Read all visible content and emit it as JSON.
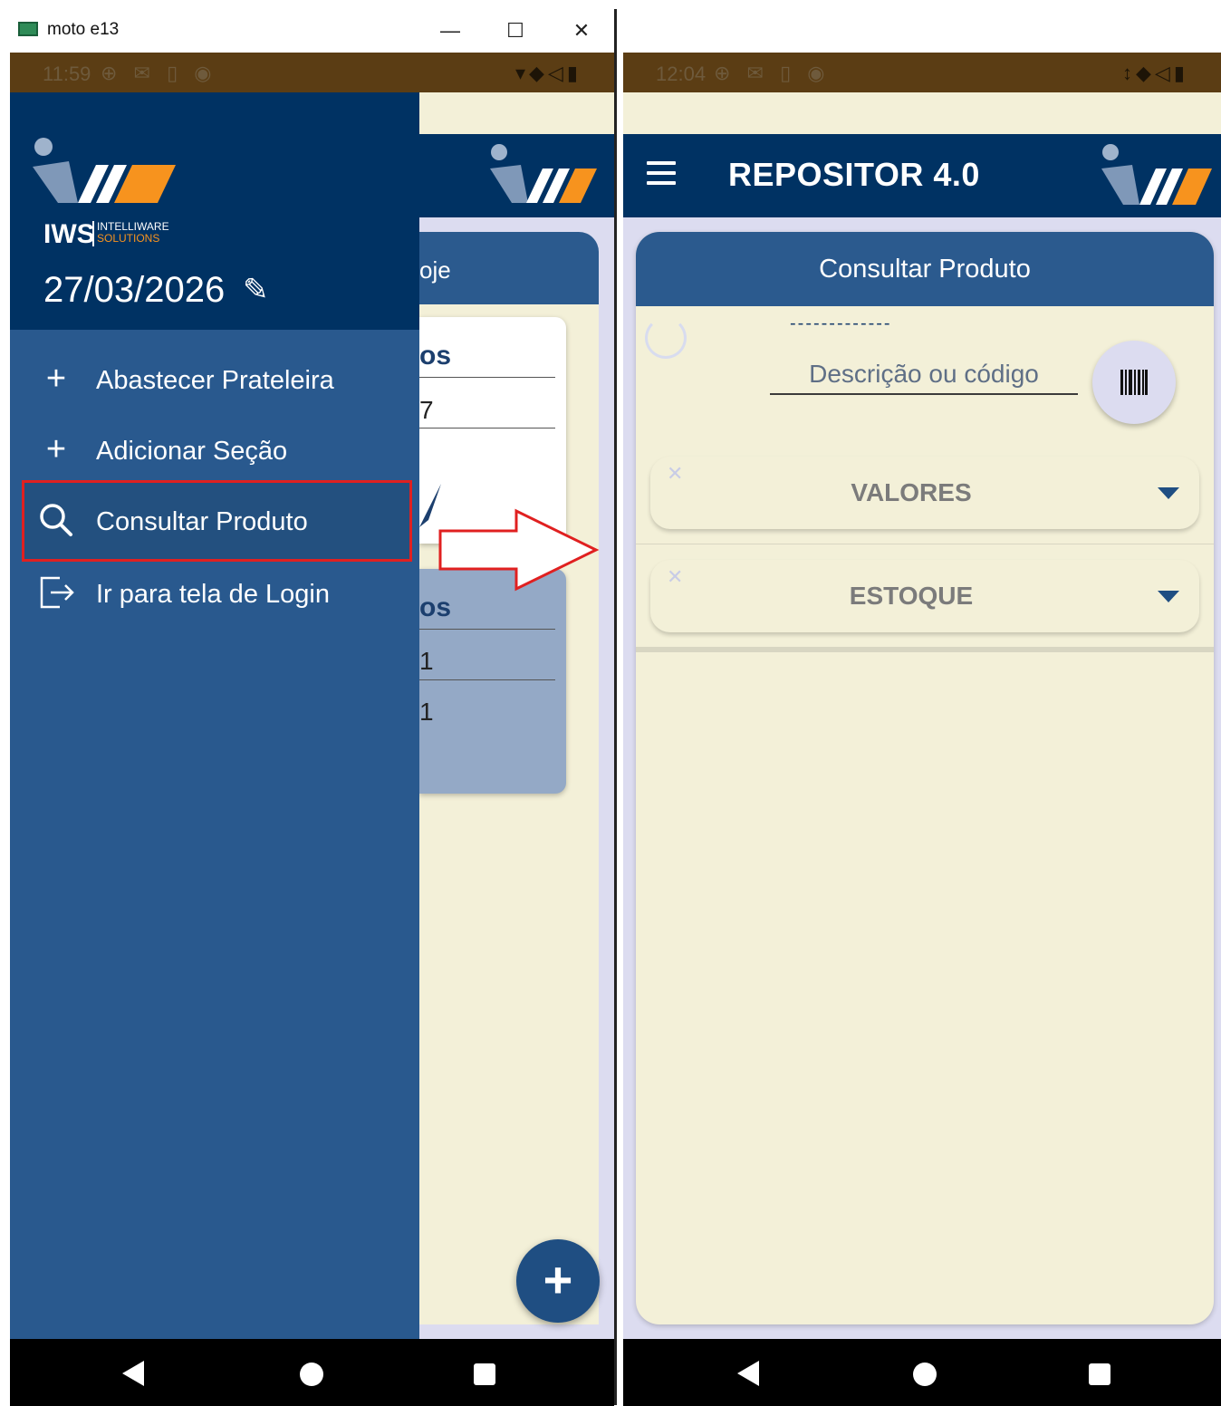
{
  "window": {
    "title": "moto e13",
    "minimize": "—",
    "maximize": "☐",
    "close": "✕"
  },
  "left_phone": {
    "status": {
      "time": "11:59",
      "left_icons": "⊕ ✉ ▯ ◉",
      "right_icons": "▾◆◁▮"
    },
    "app_behind": {
      "header_fragment": "oje",
      "white_card_heading": "os",
      "white_card_digit": "7",
      "blue_card_heading": "os",
      "blue_card_digit_1": "1",
      "blue_card_digit_2": "1",
      "fab_icon": "plus-icon"
    },
    "drawer": {
      "logo_text": "IWS",
      "logo_sub_1": "INTELLIWARE",
      "logo_sub_2": "SOLUTIONS",
      "date": "27/03/2026",
      "items": [
        {
          "label": "Abastecer Prateleira",
          "icon": "plus-icon"
        },
        {
          "label": "Adicionar Seção",
          "icon": "plus-icon"
        },
        {
          "label": "Consultar Produto",
          "icon": "search-icon",
          "highlighted": true
        },
        {
          "label": "Ir para tela de Login",
          "icon": "logout-icon"
        }
      ]
    }
  },
  "right_phone": {
    "status": {
      "time": "12:04",
      "left_icons": "⊕ ✉ ▯ ◉",
      "right_icons": "↕◆◁▮"
    },
    "appbar_title": "REPOSITOR 4.0",
    "card_title": "Consultar Produto",
    "product_dashes": "-------------",
    "search": {
      "placeholder": "Descrição ou código",
      "value": ""
    },
    "accordions": [
      {
        "label": "VALORES"
      },
      {
        "label": "ESTOQUE"
      }
    ]
  },
  "colors": {
    "drawer_header": "#003263",
    "drawer_body": "#29598e",
    "app_background": "#f3f0d8",
    "highlight_border": "#e02020",
    "logo_orange": "#f7931e"
  }
}
